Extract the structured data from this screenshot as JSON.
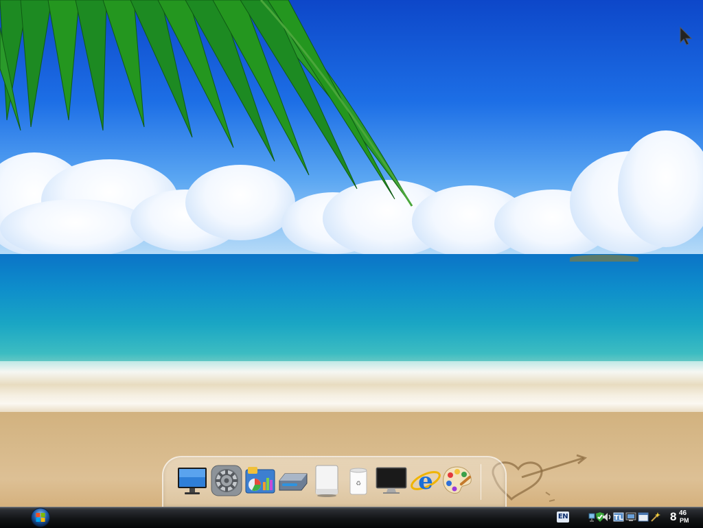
{
  "desktop": {
    "wallpaper": "tropical-beach-palm",
    "colors": {
      "sky": "#1d6fe6",
      "sea": "#0e8ecb",
      "sand": "#d7b98a"
    }
  },
  "dock": {
    "items": [
      {
        "icon": "monitor-icon"
      },
      {
        "icon": "system-preferences-icon"
      },
      {
        "icon": "control-panel-icon"
      },
      {
        "icon": "hard-drive-icon"
      },
      {
        "icon": "external-drive-icon"
      },
      {
        "icon": "recycle-bin-icon"
      },
      {
        "icon": "display-icon"
      },
      {
        "icon": "internet-explorer-icon"
      },
      {
        "icon": "paint-palette-icon"
      }
    ]
  },
  "taskbar": {
    "start_button": "start-orb-icon",
    "language": "EN",
    "tray_icons": [
      "network-icon",
      "shield-check-icon",
      "speaker-icon",
      "network-sharing-icon",
      "monitor-tray-icon",
      "wand-icon"
    ],
    "clock": {
      "hour": "8",
      "minutes": "46",
      "period": "PM"
    }
  }
}
